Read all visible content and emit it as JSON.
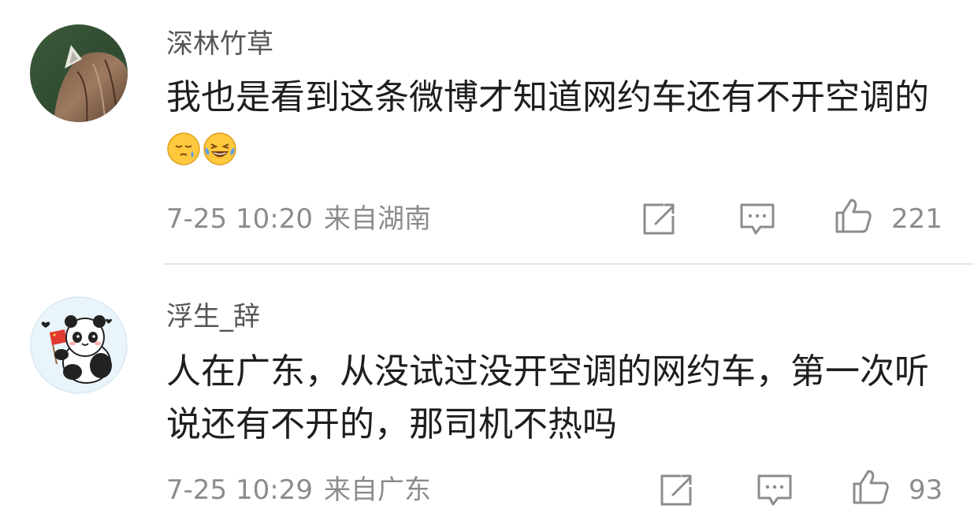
{
  "comments": [
    {
      "username": "深林竹草",
      "text": "我也是看到这条微博才知道网约车还有不开空调的",
      "emojis": [
        "sleepy-sweat-emoji",
        "laugh-cry-emoji"
      ],
      "timestamp": "7-25 10:20",
      "location": "来自湖南",
      "likes": "221",
      "avatar": "cat-ears-photo"
    },
    {
      "username": "浮生_辞",
      "text": "人在广东，从没试过没开空调的网约车，第一次听说还有不开的，那司机不热吗",
      "timestamp": "7-25 10:29",
      "location": "来自广东",
      "likes": "93",
      "avatar": "panda-flag-illustration"
    }
  ],
  "icons": {
    "share": "share-icon",
    "reply": "comment-icon",
    "like": "thumbs-up-icon"
  },
  "colors": {
    "username": "#555555",
    "text": "#1e1e1e",
    "meta": "#8c8c8c",
    "divider": "#e6e6e6"
  }
}
